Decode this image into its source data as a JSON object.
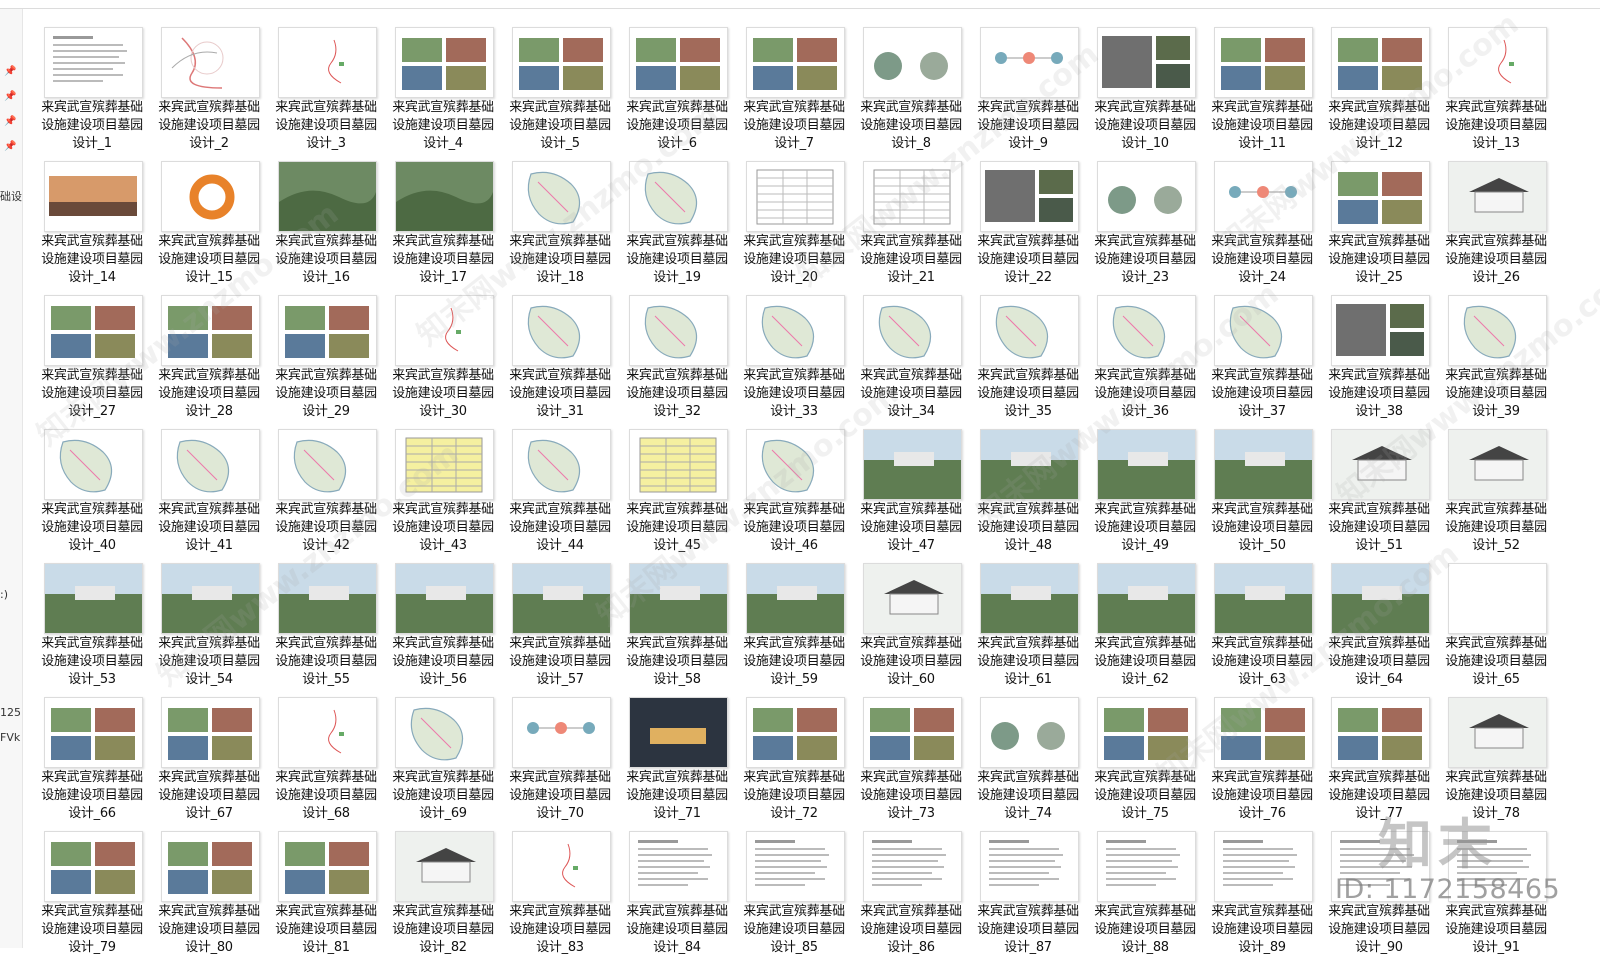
{
  "left_pane": {
    "pin_icon": "pin-icon",
    "fragments": [
      "础设",
      ":)",
      "125",
      "FVk"
    ]
  },
  "file_prefix": "来宾武宣殡葬基础设施建设项目墓园设计_",
  "files": [
    {
      "label": "来宾武宣殡葬基础设施建设项目墓园设计_1",
      "kind": "text"
    },
    {
      "label": "来宾武宣殡葬基础设施建设项目墓园设计_2",
      "kind": "map-sketch"
    },
    {
      "label": "来宾武宣殡葬基础设施建设项目墓园设计_3",
      "kind": "map-small"
    },
    {
      "label": "来宾武宣殡葬基础设施建设项目墓园设计_4",
      "kind": "photos"
    },
    {
      "label": "来宾武宣殡葬基础设施建设项目墓园设计_5",
      "kind": "photos"
    },
    {
      "label": "来宾武宣殡葬基础设施建设项目墓园设计_6",
      "kind": "photos"
    },
    {
      "label": "来宾武宣殡葬基础设施建设项目墓园设计_7",
      "kind": "photos"
    },
    {
      "label": "来宾武宣殡葬基础设施建设项目墓园设计_8",
      "kind": "circles"
    },
    {
      "label": "来宾武宣殡葬基础设施建设项目墓园设计_9",
      "kind": "diagram"
    },
    {
      "label": "来宾武宣殡葬基础设施建设项目墓园设计_10",
      "kind": "aerial"
    },
    {
      "label": "来宾武宣殡葬基础设施建设项目墓园设计_11",
      "kind": "photos"
    },
    {
      "label": "来宾武宣殡葬基础设施建设项目墓园设计_12",
      "kind": "photos"
    },
    {
      "label": "来宾武宣殡葬基础设施建设项目墓园设计_13",
      "kind": "map-small"
    },
    {
      "label": "来宾武宣殡葬基础设施建设项目墓园设计_14",
      "kind": "sunset"
    },
    {
      "label": "来宾武宣殡葬基础设施建设项目墓园设计_15",
      "kind": "ring"
    },
    {
      "label": "来宾武宣殡葬基础设施建设项目墓园设计_16",
      "kind": "landscape"
    },
    {
      "label": "来宾武宣殡葬基础设施建设项目墓园设计_17",
      "kind": "landscape"
    },
    {
      "label": "来宾武宣殡葬基础设施建设项目墓园设计_18",
      "kind": "site-plan"
    },
    {
      "label": "来宾武宣殡葬基础设施建设项目墓园设计_19",
      "kind": "site-plan"
    },
    {
      "label": "来宾武宣殡葬基础设施建设项目墓园设计_20",
      "kind": "table"
    },
    {
      "label": "来宾武宣殡葬基础设施建设项目墓园设计_21",
      "kind": "table"
    },
    {
      "label": "来宾武宣殡葬基础设施建设项目墓园设计_22",
      "kind": "aerial"
    },
    {
      "label": "来宾武宣殡葬基础设施建设项目墓园设计_23",
      "kind": "circles"
    },
    {
      "label": "来宾武宣殡葬基础设施建设项目墓园设计_24",
      "kind": "diagram"
    },
    {
      "label": "来宾武宣殡葬基础设施建设项目墓园设计_25",
      "kind": "photos"
    },
    {
      "label": "来宾武宣殡葬基础设施建设项目墓园设计_26",
      "kind": "building"
    },
    {
      "label": "来宾武宣殡葬基础设施建设项目墓园设计_27",
      "kind": "photos"
    },
    {
      "label": "来宾武宣殡葬基础设施建设项目墓园设计_28",
      "kind": "photos"
    },
    {
      "label": "来宾武宣殡葬基础设施建设项目墓园设计_29",
      "kind": "photos"
    },
    {
      "label": "来宾武宣殡葬基础设施建设项目墓园设计_30",
      "kind": "map-small"
    },
    {
      "label": "来宾武宣殡葬基础设施建设项目墓园设计_31",
      "kind": "site-plan"
    },
    {
      "label": "来宾武宣殡葬基础设施建设项目墓园设计_32",
      "kind": "site-plan"
    },
    {
      "label": "来宾武宣殡葬基础设施建设项目墓园设计_33",
      "kind": "site-plan"
    },
    {
      "label": "来宾武宣殡葬基础设施建设项目墓园设计_34",
      "kind": "site-plan"
    },
    {
      "label": "来宾武宣殡葬基础设施建设项目墓园设计_35",
      "kind": "site-plan"
    },
    {
      "label": "来宾武宣殡葬基础设施建设项目墓园设计_36",
      "kind": "site-plan"
    },
    {
      "label": "来宾武宣殡葬基础设施建设项目墓园设计_37",
      "kind": "site-plan"
    },
    {
      "label": "来宾武宣殡葬基础设施建设项目墓园设计_38",
      "kind": "aerial"
    },
    {
      "label": "来宾武宣殡葬基础设施建设项目墓园设计_39",
      "kind": "site-plan"
    },
    {
      "label": "来宾武宣殡葬基础设施建设项目墓园设计_40",
      "kind": "site-plan"
    },
    {
      "label": "来宾武宣殡葬基础设施建设项目墓园设计_41",
      "kind": "site-plan"
    },
    {
      "label": "来宾武宣殡葬基础设施建设项目墓园设计_42",
      "kind": "site-plan"
    },
    {
      "label": "来宾武宣殡葬基础设施建设项目墓园设计_43",
      "kind": "table-yellow"
    },
    {
      "label": "来宾武宣殡葬基础设施建设项目墓园设计_44",
      "kind": "site-plan"
    },
    {
      "label": "来宾武宣殡葬基础设施建设项目墓园设计_45",
      "kind": "table-yellow"
    },
    {
      "label": "来宾武宣殡葬基础设施建设项目墓园设计_46",
      "kind": "site-plan"
    },
    {
      "label": "来宾武宣殡葬基础设施建设项目墓园设计_47",
      "kind": "render"
    },
    {
      "label": "来宾武宣殡葬基础设施建设项目墓园设计_48",
      "kind": "render"
    },
    {
      "label": "来宾武宣殡葬基础设施建设项目墓园设计_49",
      "kind": "render"
    },
    {
      "label": "来宾武宣殡葬基础设施建设项目墓园设计_50",
      "kind": "render"
    },
    {
      "label": "来宾武宣殡葬基础设施建设项目墓园设计_51",
      "kind": "building"
    },
    {
      "label": "来宾武宣殡葬基础设施建设项目墓园设计_52",
      "kind": "building"
    },
    {
      "label": "来宾武宣殡葬基础设施建设项目墓园设计_53",
      "kind": "render"
    },
    {
      "label": "来宾武宣殡葬基础设施建设项目墓园设计_54",
      "kind": "render"
    },
    {
      "label": "来宾武宣殡葬基础设施建设项目墓园设计_55",
      "kind": "render"
    },
    {
      "label": "来宾武宣殡葬基础设施建设项目墓园设计_56",
      "kind": "render"
    },
    {
      "label": "来宾武宣殡葬基础设施建设项目墓园设计_57",
      "kind": "render"
    },
    {
      "label": "来宾武宣殡葬基础设施建设项目墓园设计_58",
      "kind": "render"
    },
    {
      "label": "来宾武宣殡葬基础设施建设项目墓园设计_59",
      "kind": "render"
    },
    {
      "label": "来宾武宣殡葬基础设施建设项目墓园设计_60",
      "kind": "building"
    },
    {
      "label": "来宾武宣殡葬基础设施建设项目墓园设计_61",
      "kind": "render"
    },
    {
      "label": "来宾武宣殡葬基础设施建设项目墓园设计_62",
      "kind": "render"
    },
    {
      "label": "来宾武宣殡葬基础设施建设项目墓园设计_63",
      "kind": "render"
    },
    {
      "label": "来宾武宣殡葬基础设施建设项目墓园设计_64",
      "kind": "render"
    },
    {
      "label": "来宾武宣殡葬基础设施建设项目墓园设计_65",
      "kind": "blank"
    },
    {
      "label": "来宾武宣殡葬基础设施建设项目墓园设计_66",
      "kind": "photos"
    },
    {
      "label": "来宾武宣殡葬基础设施建设项目墓园设计_67",
      "kind": "photos"
    },
    {
      "label": "来宾武宣殡葬基础设施建设项目墓园设计_68",
      "kind": "map-small"
    },
    {
      "label": "来宾武宣殡葬基础设施建设项目墓园设计_69",
      "kind": "site-plan"
    },
    {
      "label": "来宾武宣殡葬基础设施建设项目墓园设计_70",
      "kind": "diagram"
    },
    {
      "label": "来宾武宣殡葬基础设施建设项目墓园设计_71",
      "kind": "night"
    },
    {
      "label": "来宾武宣殡葬基础设施建设项目墓园设计_72",
      "kind": "photos"
    },
    {
      "label": "来宾武宣殡葬基础设施建设项目墓园设计_73",
      "kind": "photos"
    },
    {
      "label": "来宾武宣殡葬基础设施建设项目墓园设计_74",
      "kind": "circles"
    },
    {
      "label": "来宾武宣殡葬基础设施建设项目墓园设计_75",
      "kind": "photos"
    },
    {
      "label": "来宾武宣殡葬基础设施建设项目墓园设计_76",
      "kind": "photos"
    },
    {
      "label": "来宾武宣殡葬基础设施建设项目墓园设计_77",
      "kind": "photos"
    },
    {
      "label": "来宾武宣殡葬基础设施建设项目墓园设计_78",
      "kind": "building"
    },
    {
      "label": "来宾武宣殡葬基础设施建设项目墓园设计_79",
      "kind": "photos"
    },
    {
      "label": "来宾武宣殡葬基础设施建设项目墓园设计_80",
      "kind": "photos"
    },
    {
      "label": "来宾武宣殡葬基础设施建设项目墓园设计_81",
      "kind": "photos"
    },
    {
      "label": "来宾武宣殡葬基础设施建设项目墓园设计_82",
      "kind": "building"
    },
    {
      "label": "来宾武宣殡葬基础设施建设项目墓园设计_83",
      "kind": "map-small"
    },
    {
      "label": "来宾武宣殡葬基础设施建设项目墓园设计_84",
      "kind": "text"
    },
    {
      "label": "来宾武宣殡葬基础设施建设项目墓园设计_85",
      "kind": "text"
    },
    {
      "label": "来宾武宣殡葬基础设施建设项目墓园设计_86",
      "kind": "text"
    },
    {
      "label": "来宾武宣殡葬基础设施建设项目墓园设计_87",
      "kind": "text"
    },
    {
      "label": "来宾武宣殡葬基础设施建设项目墓园设计_88",
      "kind": "text"
    },
    {
      "label": "来宾武宣殡葬基础设施建设项目墓园设计_89",
      "kind": "text"
    },
    {
      "label": "来宾武宣殡葬基础设施建设项目墓园设计_90",
      "kind": "text"
    },
    {
      "label": "来宾武宣殡葬基础设施建设项目墓园设计_91",
      "kind": "text"
    }
  ],
  "watermarks": {
    "diagonal": "知末网www.znzmo.com",
    "logo": "知末",
    "id_text": "ID: 1172158465"
  },
  "colors": {
    "thumb_border": "#dcdcdc",
    "label_text": "#111111",
    "background": "#ffffff"
  }
}
